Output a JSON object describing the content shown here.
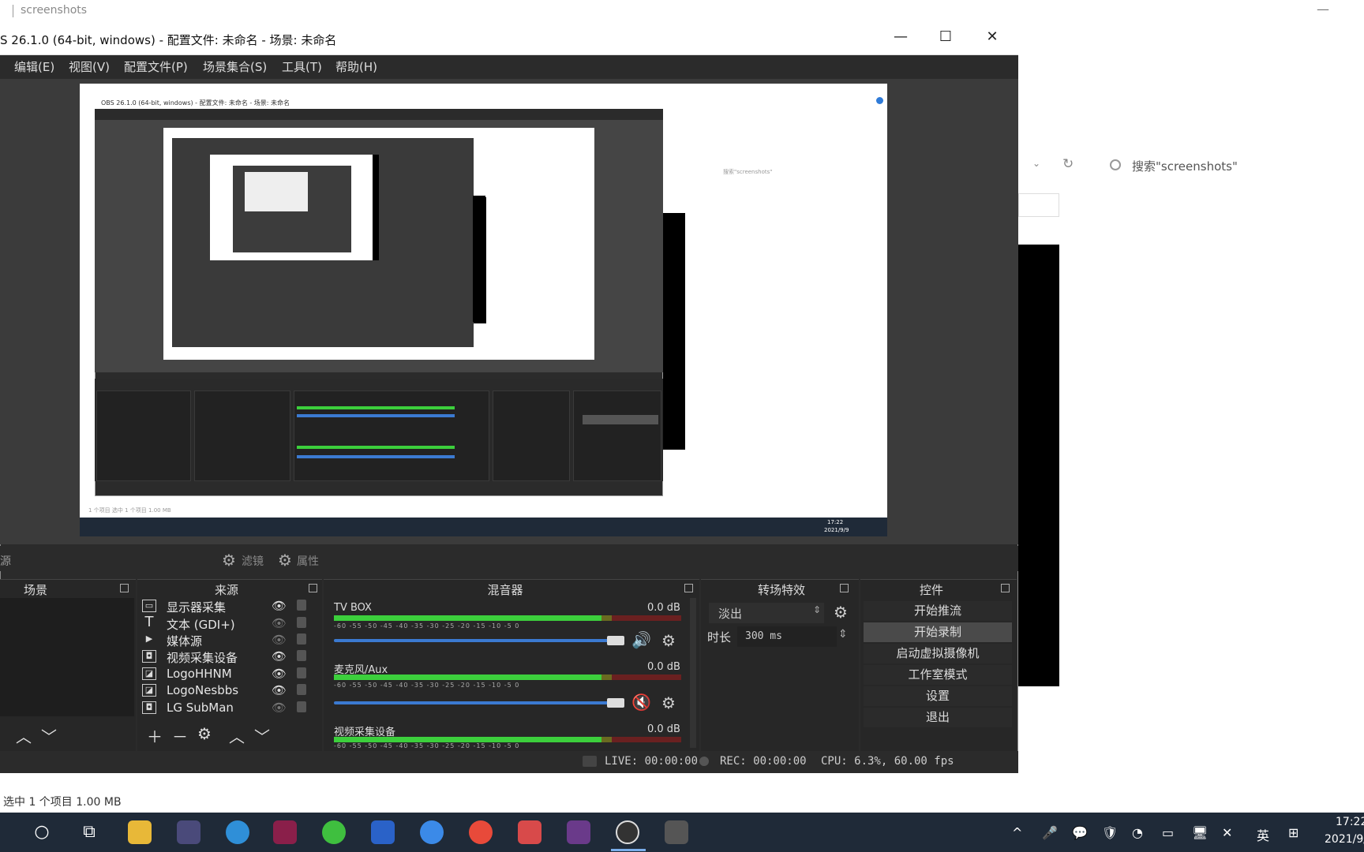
{
  "explorer": {
    "title": "screenshots",
    "search_placeholder": "搜索\"screenshots\"",
    "status": "选中 1 个项目  1.00 MB",
    "minimize": "—"
  },
  "obs": {
    "title": "S 26.1.0 (64-bit, windows) - 配置文件: 未命名 - 场景: 未命名",
    "window_buttons": [
      "—",
      "☐",
      "✕"
    ],
    "menu": [
      "编辑(E)",
      "视图(V)",
      "配置文件(P)",
      "场景集合(S)",
      "工具(T)",
      "帮助(H)"
    ],
    "left_fragment": "源",
    "filters_label": "滤镜",
    "properties_label": "属性",
    "docks": {
      "scenes": "场景",
      "sources": "来源",
      "mixer": "混音器",
      "transitions": "转场特效",
      "controls": "控件"
    },
    "sources": [
      {
        "label": "显示器采集",
        "icon": "monitor-icon",
        "glyph": "▭",
        "visible": true
      },
      {
        "label": "文本 (GDI+)",
        "icon": "text-icon",
        "glyph": "T",
        "visible": false
      },
      {
        "label": "媒体源",
        "icon": "play-icon",
        "glyph": "▶",
        "visible": false
      },
      {
        "label": "视频采集设备",
        "icon": "camera-icon",
        "glyph": "◘",
        "visible": true
      },
      {
        "label": "LogoHHNM",
        "icon": "image-icon",
        "glyph": "◪",
        "visible": true
      },
      {
        "label": "LogoNesbbs",
        "icon": "image-icon",
        "glyph": "◪",
        "visible": true
      },
      {
        "label": "LG SubMan",
        "icon": "camera-icon",
        "glyph": "◘",
        "visible": false
      }
    ],
    "mixer": [
      {
        "name": "TV BOX",
        "db": "0.0 dB",
        "level": 0.77,
        "muted": false
      },
      {
        "name": "麦克风/Aux",
        "db": "0.0 dB",
        "level": 0.77,
        "muted": true
      },
      {
        "name": "视频采集设备",
        "db": "0.0 dB",
        "level": 0.77,
        "muted": false
      }
    ],
    "mixer_ticks": "-60  -55  -50  -45  -40  -35  -30  -25  -20  -15  -10  -5  0",
    "transition": {
      "type": "淡出",
      "duration_label": "时长",
      "duration_value": "300 ms"
    },
    "controls": [
      "开始推流",
      "开始录制",
      "启动虚拟摄像机",
      "工作室模式",
      "设置",
      "退出"
    ],
    "status": {
      "live": "LIVE: 00:00:00",
      "rec": "REC: 00:00:00",
      "cpu": "CPU: 6.3%, 60.00 fps"
    }
  },
  "nested": {
    "title": "OBS 26.1.0 (64-bit, windows) - 配置文件: 未命名 - 场景: 未命名",
    "search": "搜索\"screenshots\"",
    "clock": "17:22",
    "date": "2021/9/9",
    "status": "1 个项目  选中 1 个项目 1.00 MB"
  },
  "taskbar": {
    "clock_time": "17:22",
    "clock_date": "2021/9/",
    "tray": [
      "^",
      "🎤",
      "💬",
      "🛡",
      "◔",
      "▭",
      "🖥",
      "✕",
      "英",
      "⊞"
    ]
  },
  "colors": {
    "obs_bg": "#2b2b2b",
    "accent": "#3b7ad1",
    "taskbar": "#1f2a38"
  }
}
